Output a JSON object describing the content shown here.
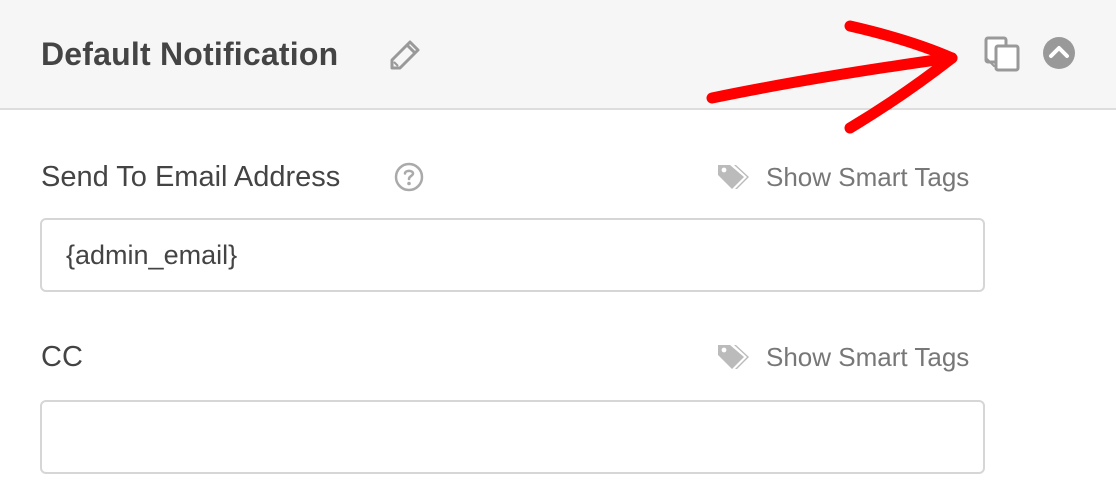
{
  "header": {
    "title": "Default Notification",
    "edit_icon": "pencil-icon",
    "clone_icon": "clone-icon",
    "toggle_icon": "chevron-up-circle-icon",
    "annotation": "red-arrow-pointing-to-clone-icon",
    "annotation_color": "#ff0000"
  },
  "fields": [
    {
      "label": "Send To Email Address",
      "help_icon": "question-circle-icon",
      "smart_tags_label": "Show Smart Tags",
      "smart_tags_icon": "tags-icon",
      "value": "{admin_email}",
      "placeholder": ""
    },
    {
      "label": "CC",
      "smart_tags_label": "Show Smart Tags",
      "smart_tags_icon": "tags-icon",
      "value": "",
      "placeholder": ""
    }
  ],
  "colors": {
    "header_bg": "#f6f6f6",
    "text": "#444444",
    "muted_text": "#777777",
    "icon": "#999999",
    "border": "#d6d6d6"
  }
}
